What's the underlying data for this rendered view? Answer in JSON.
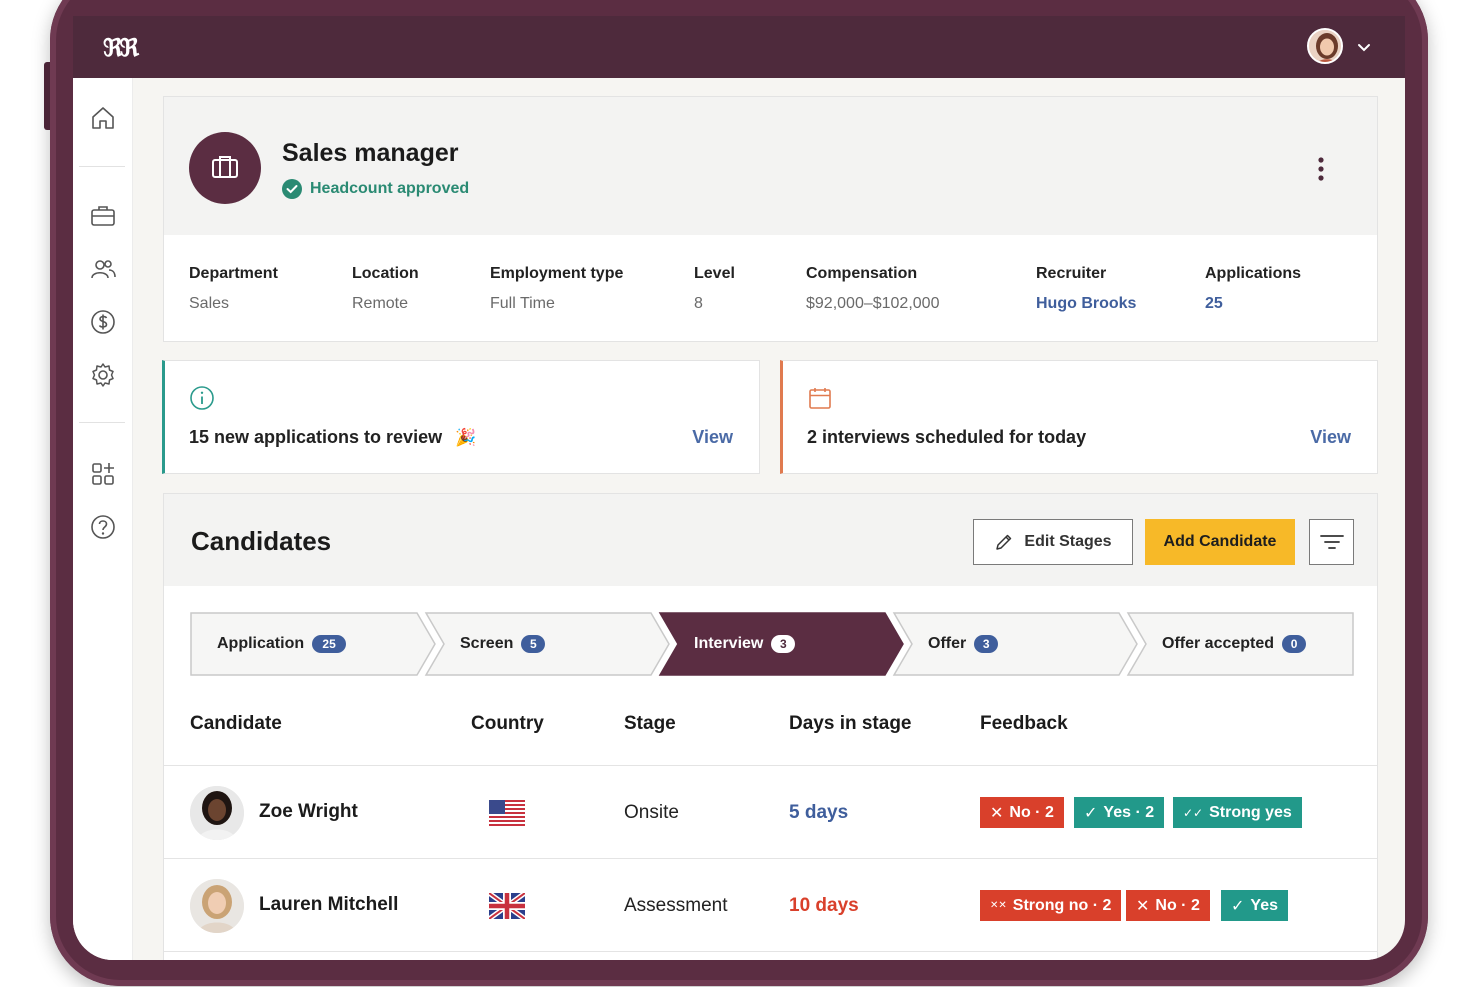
{
  "app": {
    "logo": "ℜℜ"
  },
  "job": {
    "title": "Sales manager",
    "status": "Headcount approved",
    "meta": [
      {
        "label": "Department",
        "value": "Sales"
      },
      {
        "label": "Location",
        "value": "Remote"
      },
      {
        "label": "Employment type",
        "value": "Full Time"
      },
      {
        "label": "Level",
        "value": "8"
      },
      {
        "label": "Compensation",
        "value": "$92,000–$102,000"
      },
      {
        "label": "Recruiter",
        "value": "Hugo Brooks"
      },
      {
        "label": "Applications",
        "value": "25"
      }
    ]
  },
  "alerts": [
    {
      "text": "15 new applications to review",
      "emoji": "🎉",
      "action": "View"
    },
    {
      "text": "2 interviews scheduled for today",
      "action": "View"
    }
  ],
  "candidates": {
    "title": "Candidates",
    "edit_label": "Edit Stages",
    "add_label": "Add Candidate",
    "stages": [
      {
        "label": "Application",
        "count": "25",
        "active": false
      },
      {
        "label": "Screen",
        "count": "5",
        "active": false
      },
      {
        "label": "Interview",
        "count": "3",
        "active": true
      },
      {
        "label": "Offer",
        "count": "3",
        "active": false
      },
      {
        "label": "Offer accepted",
        "count": "0",
        "active": false
      }
    ],
    "columns": [
      "Candidate",
      "Country",
      "Stage",
      "Days in stage",
      "Feedback"
    ],
    "rows": [
      {
        "name": "Zoe Wright",
        "country_flag": "us-flag-icon",
        "stage": "Onsite",
        "days": "5 days",
        "days_color": "#3f5e9c",
        "feedback": [
          {
            "label": "No · 2",
            "icon": "✕",
            "tone": "red"
          },
          {
            "label": "Yes · 2",
            "icon": "✓",
            "tone": "green"
          },
          {
            "label": "Strong yes",
            "icon": "✓✓",
            "tone": "green"
          }
        ]
      },
      {
        "name": "Lauren Mitchell",
        "country_flag": "uk-flag-icon",
        "stage": "Assessment",
        "days": "10 days",
        "days_color": "#d9402b",
        "feedback": [
          {
            "label": "Strong no · 2",
            "icon": "✕✕",
            "tone": "red"
          },
          {
            "label": "No · 2",
            "icon": "✕",
            "tone": "red"
          },
          {
            "label": "Yes",
            "icon": "✓",
            "tone": "green"
          }
        ]
      }
    ]
  },
  "colors": {
    "brand": "#5b2d42",
    "topbar": "#4e2a3c",
    "accent_yellow": "#f7b928",
    "link_blue": "#3f5e9c",
    "approved_green": "#2a8a73",
    "feedback_red": "#d9402b",
    "feedback_green": "#22998a"
  }
}
